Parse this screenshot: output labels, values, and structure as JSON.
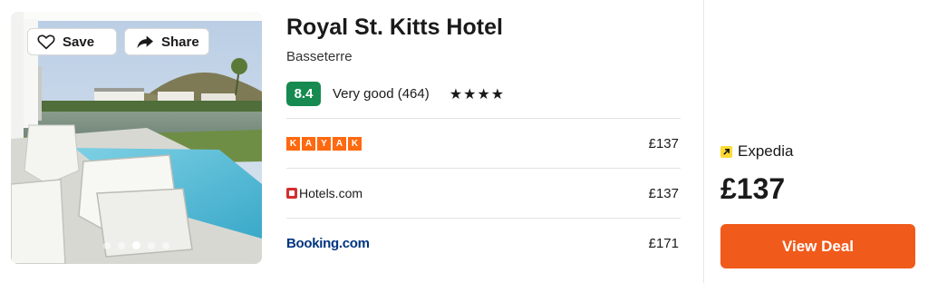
{
  "photo": {
    "save_label": "Save",
    "share_label": "Share",
    "carousel_dots": 5,
    "active_dot": 3
  },
  "hotel": {
    "name": "Royal St. Kitts Hotel",
    "location": "Basseterre",
    "score": "8.4",
    "rating_text": "Very good (464)",
    "stars_display": "★★★★",
    "star_count": 4
  },
  "providers": [
    {
      "name": "KAYAK",
      "price": "£137"
    },
    {
      "name": "Hotels.com",
      "price": "£137"
    },
    {
      "name": "Booking.com",
      "price": "£171"
    }
  ],
  "deal": {
    "provider": "Expedia",
    "price": "£137",
    "button_label": "View Deal"
  },
  "colors": {
    "score_bg": "#168a50",
    "cta_bg": "#f05a1a",
    "kayak_orange": "#ff690f",
    "booking_blue": "#003580",
    "expedia_yellow": "#fddb32"
  }
}
